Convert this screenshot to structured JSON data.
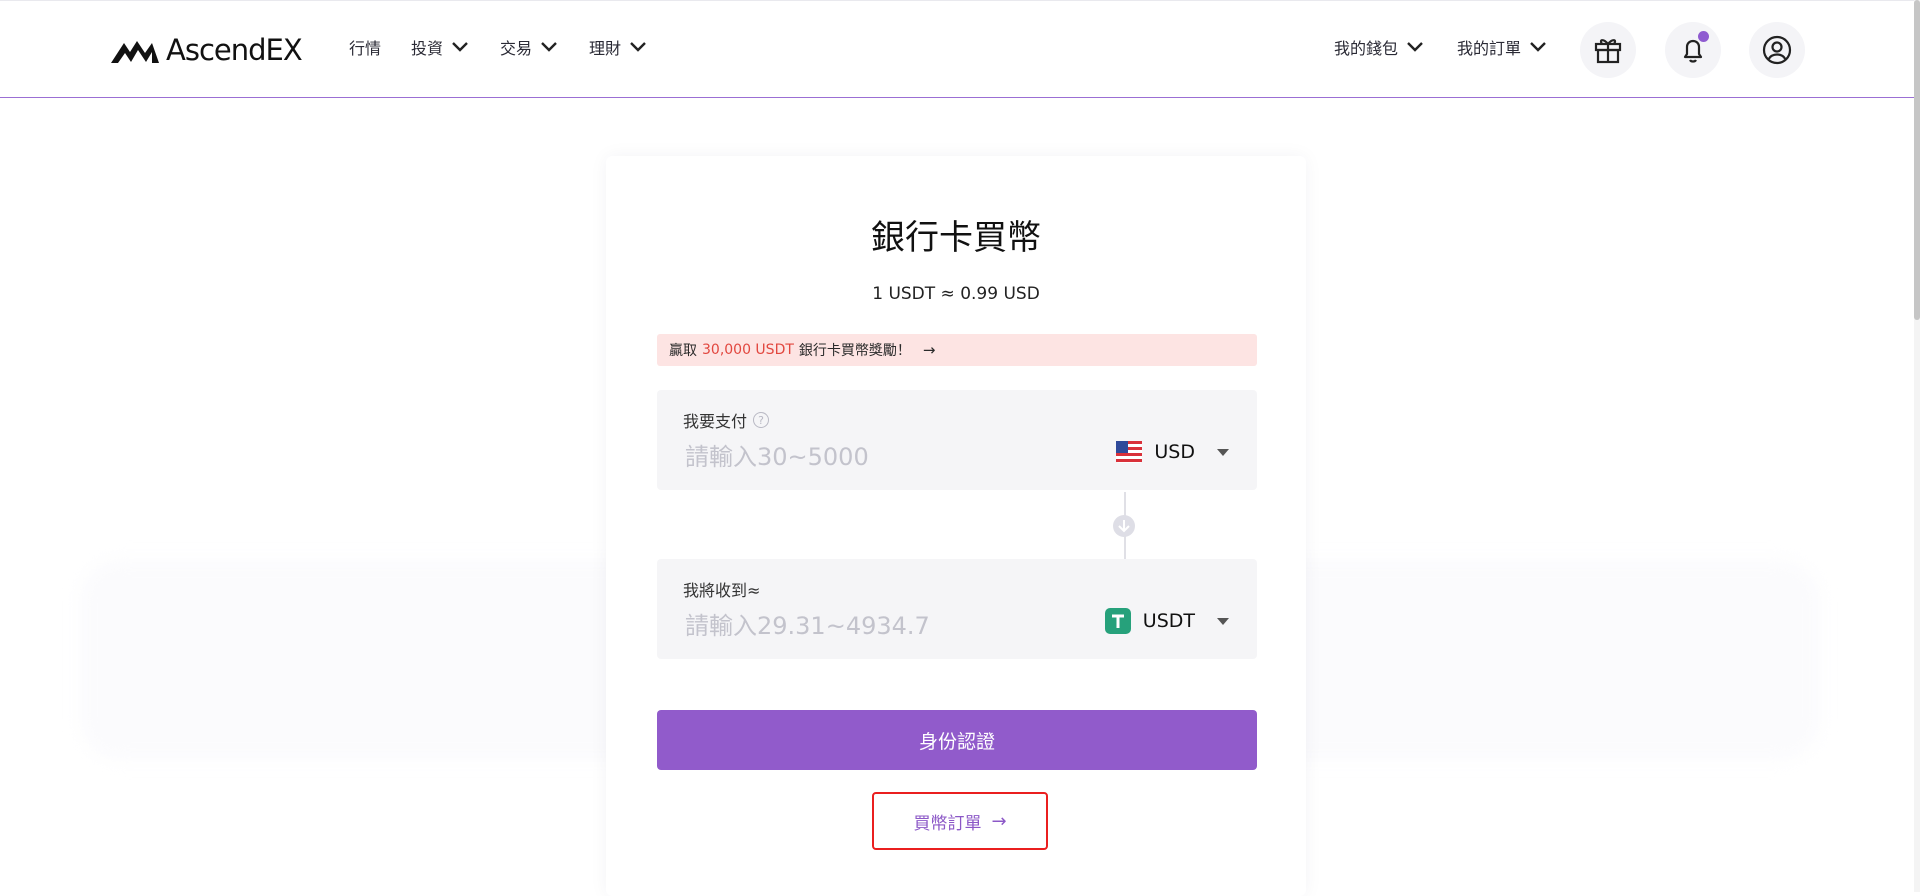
{
  "brand": {
    "name": "AscendEX",
    "accent": "#915bcb",
    "highlight": "#e2473f"
  },
  "nav": {
    "items": [
      {
        "label": "行情",
        "dropdown": false
      },
      {
        "label": "投資",
        "dropdown": true
      },
      {
        "label": "交易",
        "dropdown": true
      },
      {
        "label": "理財",
        "dropdown": true
      }
    ],
    "wallet_label": "我的錢包",
    "orders_label": "我的訂單",
    "icons": [
      "gift-icon",
      "bell-icon",
      "user-icon"
    ]
  },
  "page": {
    "title": "銀行卡買幣",
    "rate": "1 USDT ≈ 0.99 USD",
    "promo": {
      "prefix": "贏取",
      "highlight": "30,000 USDT",
      "suffix": "銀行卡買幣獎勵！",
      "arrow": "→"
    },
    "pay": {
      "label": "我要支付",
      "placeholder": "請輸入30~5000",
      "currency": "USD",
      "currency_icon": "us-flag-icon"
    },
    "receive": {
      "label": "我將收到≈",
      "placeholder": "請輸入29.31~4934.7",
      "currency": "USDT",
      "currency_icon": "tether-icon"
    },
    "submit_label": "身份認證",
    "orders_link": "買幣訂單"
  }
}
